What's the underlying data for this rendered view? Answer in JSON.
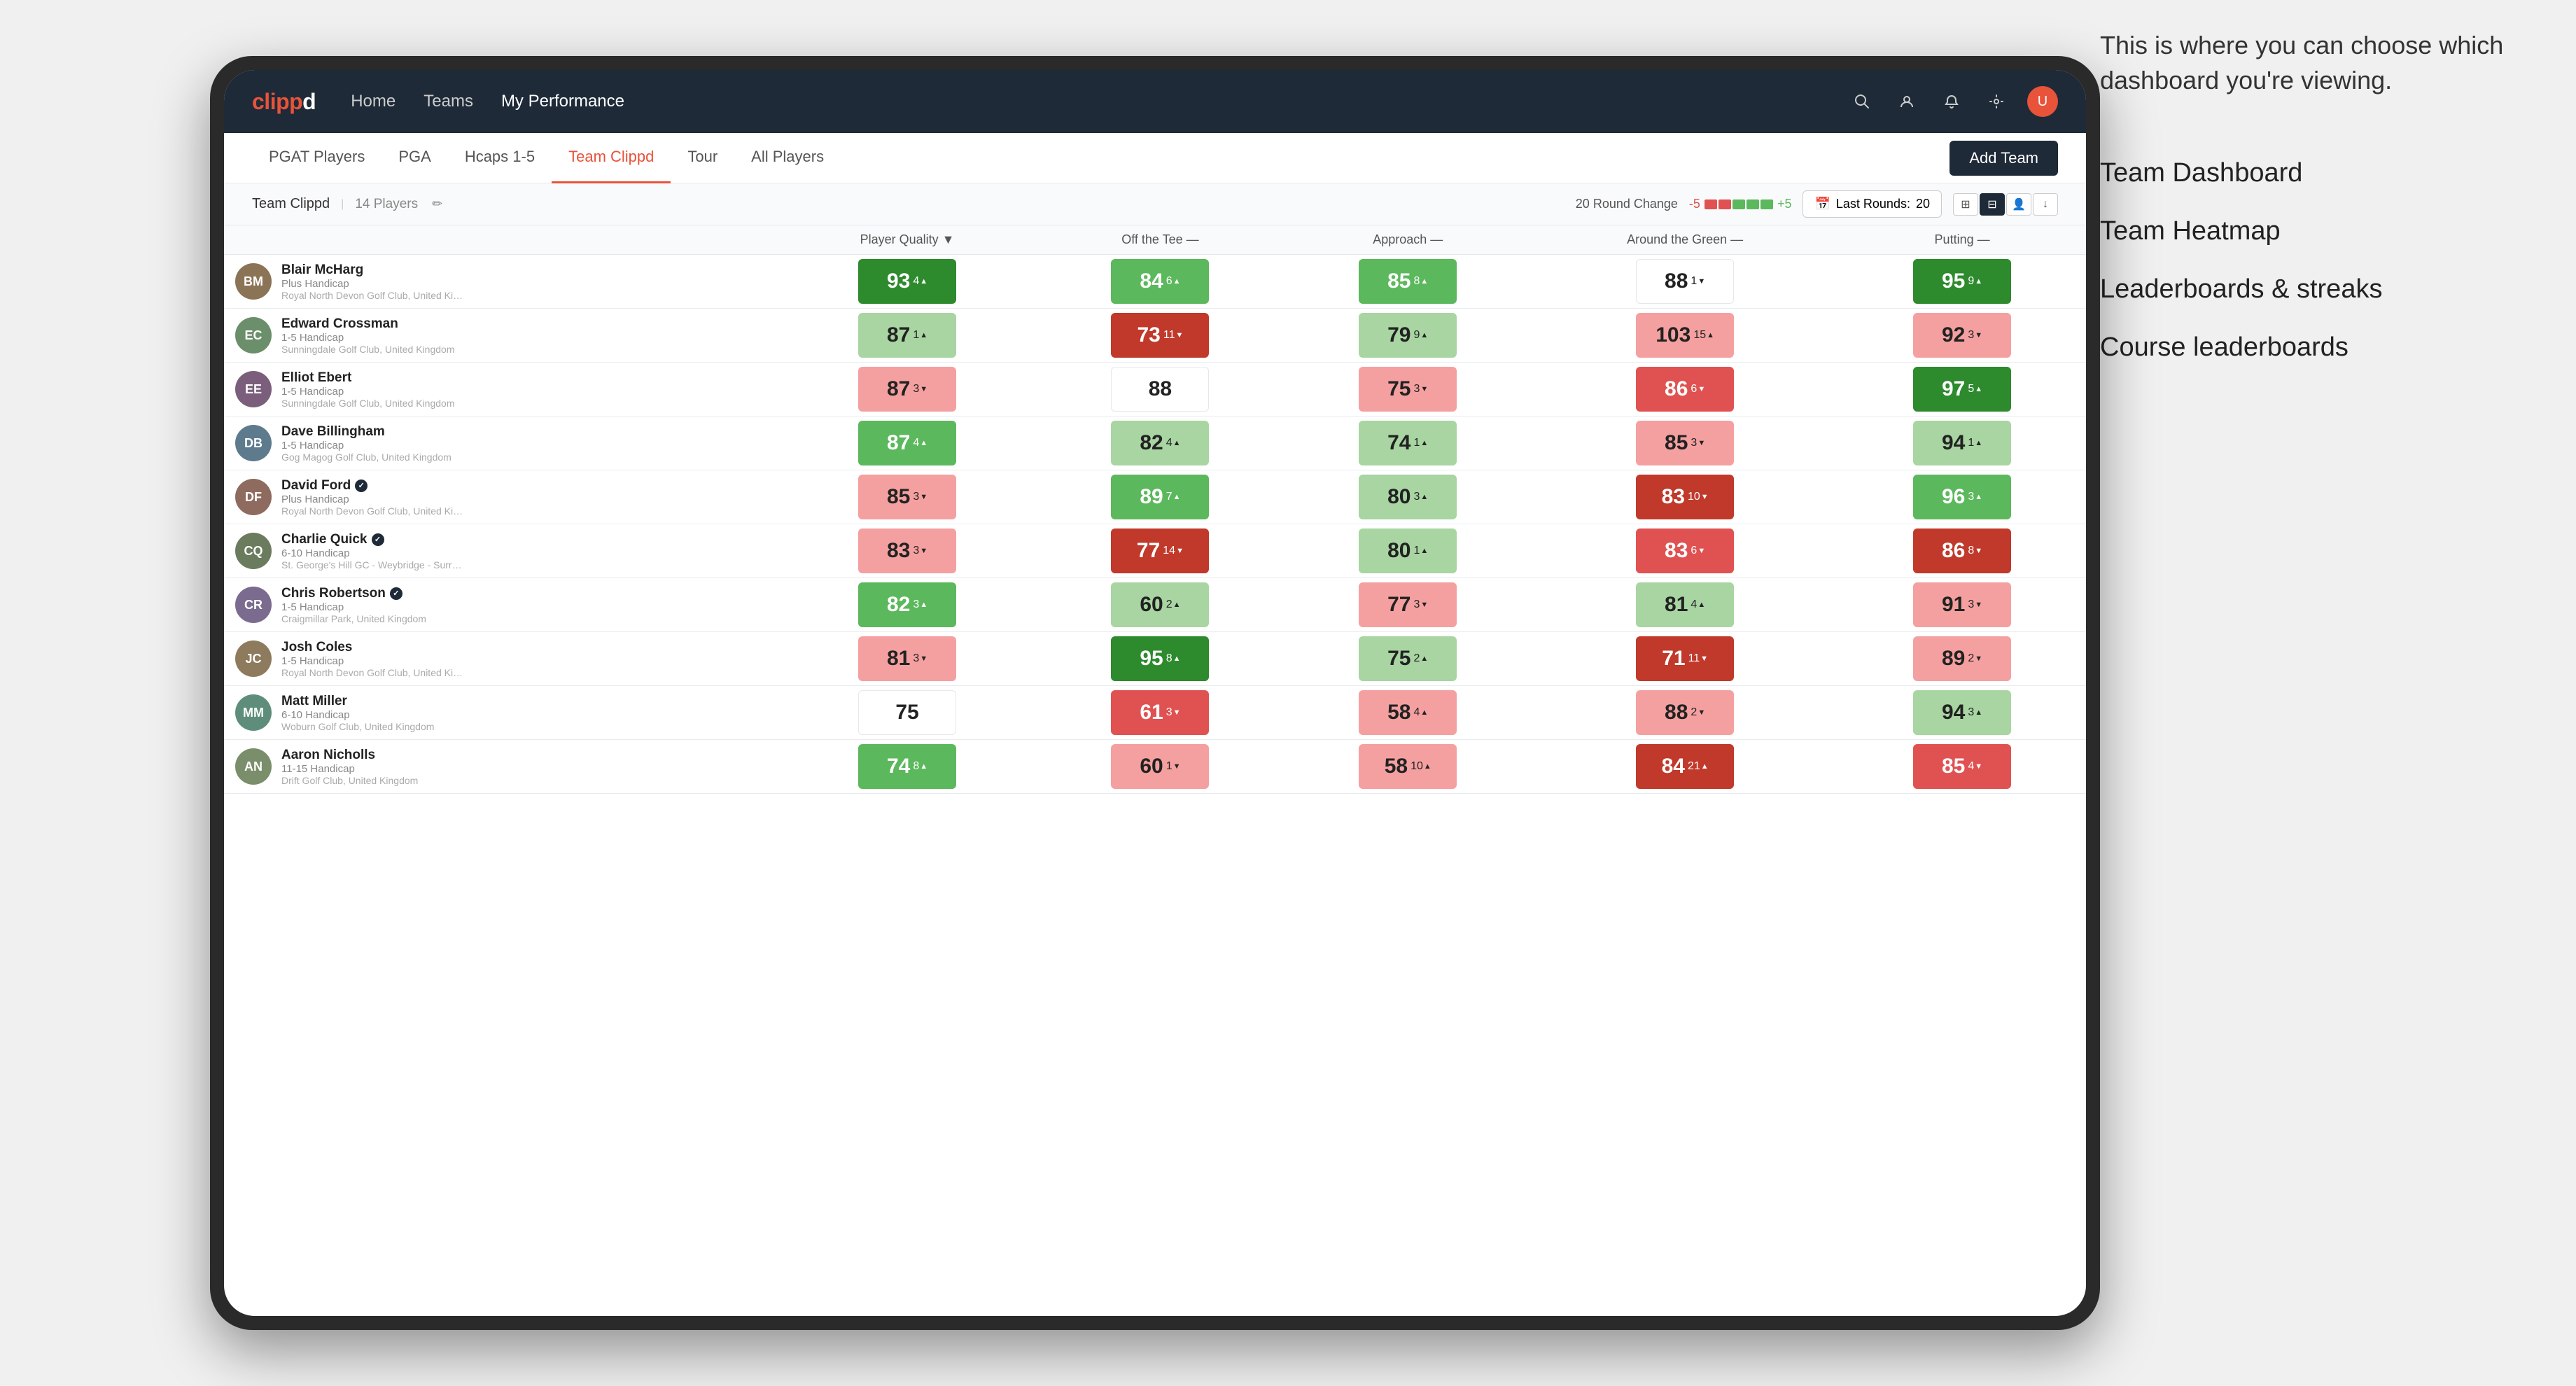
{
  "annotation": {
    "intro": "This is where you can choose which dashboard you're viewing.",
    "items": [
      "Team Dashboard",
      "Team Heatmap",
      "Leaderboards & streaks",
      "Course leaderboards"
    ]
  },
  "nav": {
    "logo": "clippd",
    "links": [
      "Home",
      "Teams",
      "My Performance"
    ],
    "active_link": "My Performance"
  },
  "sub_nav": {
    "links": [
      "PGAT Players",
      "PGA",
      "Hcaps 1-5",
      "Team Clippd",
      "Tour",
      "All Players"
    ],
    "active": "Team Clippd",
    "add_team_label": "Add Team"
  },
  "team_bar": {
    "team_name": "Team Clippd",
    "player_count": "14 Players",
    "round_change_label": "20 Round Change",
    "minus_num": "-5",
    "plus_num": "+5",
    "last_rounds_label": "Last Rounds:",
    "last_rounds_value": "20",
    "calendar_icon": "calendar"
  },
  "table": {
    "headers": {
      "player": "Player Quality ▼",
      "tee": "Off the Tee —",
      "approach": "Approach —",
      "around": "Around the Green —",
      "putting": "Putting —"
    },
    "rows": [
      {
        "name": "Blair McHarg",
        "handicap": "Plus Handicap",
        "club": "Royal North Devon Golf Club, United Kingdom",
        "badge": false,
        "quality": {
          "score": 93,
          "delta": "4",
          "dir": "up",
          "color": "green-dark"
        },
        "tee": {
          "score": 84,
          "delta": "6",
          "dir": "up",
          "color": "green-mid"
        },
        "approach": {
          "score": 85,
          "delta": "8",
          "dir": "up",
          "color": "green-mid"
        },
        "around": {
          "score": 88,
          "delta": "1",
          "dir": "down",
          "color": "white"
        },
        "putting": {
          "score": 95,
          "delta": "9",
          "dir": "up",
          "color": "green-dark"
        }
      },
      {
        "name": "Edward Crossman",
        "handicap": "1-5 Handicap",
        "club": "Sunningdale Golf Club, United Kingdom",
        "badge": false,
        "quality": {
          "score": 87,
          "delta": "1",
          "dir": "up",
          "color": "green-light"
        },
        "tee": {
          "score": 73,
          "delta": "11",
          "dir": "down",
          "color": "red-dark"
        },
        "approach": {
          "score": 79,
          "delta": "9",
          "dir": "up",
          "color": "green-light"
        },
        "around": {
          "score": 103,
          "delta": "15",
          "dir": "up",
          "color": "red-light"
        },
        "putting": {
          "score": 92,
          "delta": "3",
          "dir": "down",
          "color": "red-light"
        }
      },
      {
        "name": "Elliot Ebert",
        "handicap": "1-5 Handicap",
        "club": "Sunningdale Golf Club, United Kingdom",
        "badge": false,
        "quality": {
          "score": 87,
          "delta": "3",
          "dir": "down",
          "color": "red-light"
        },
        "tee": {
          "score": 88,
          "delta": "",
          "dir": "",
          "color": "white"
        },
        "approach": {
          "score": 75,
          "delta": "3",
          "dir": "down",
          "color": "red-light"
        },
        "around": {
          "score": 86,
          "delta": "6",
          "dir": "down",
          "color": "red-mid"
        },
        "putting": {
          "score": 97,
          "delta": "5",
          "dir": "up",
          "color": "green-dark"
        }
      },
      {
        "name": "Dave Billingham",
        "handicap": "1-5 Handicap",
        "club": "Gog Magog Golf Club, United Kingdom",
        "badge": false,
        "quality": {
          "score": 87,
          "delta": "4",
          "dir": "up",
          "color": "green-mid"
        },
        "tee": {
          "score": 82,
          "delta": "4",
          "dir": "up",
          "color": "green-light"
        },
        "approach": {
          "score": 74,
          "delta": "1",
          "dir": "up",
          "color": "green-light"
        },
        "around": {
          "score": 85,
          "delta": "3",
          "dir": "down",
          "color": "red-light"
        },
        "putting": {
          "score": 94,
          "delta": "1",
          "dir": "up",
          "color": "green-light"
        }
      },
      {
        "name": "David Ford",
        "handicap": "Plus Handicap",
        "club": "Royal North Devon Golf Club, United Kingdom",
        "badge": true,
        "quality": {
          "score": 85,
          "delta": "3",
          "dir": "down",
          "color": "red-light"
        },
        "tee": {
          "score": 89,
          "delta": "7",
          "dir": "up",
          "color": "green-mid"
        },
        "approach": {
          "score": 80,
          "delta": "3",
          "dir": "up",
          "color": "green-light"
        },
        "around": {
          "score": 83,
          "delta": "10",
          "dir": "down",
          "color": "red-dark"
        },
        "putting": {
          "score": 96,
          "delta": "3",
          "dir": "up",
          "color": "green-mid"
        }
      },
      {
        "name": "Charlie Quick",
        "handicap": "6-10 Handicap",
        "club": "St. George's Hill GC - Weybridge - Surrey, Uni...",
        "badge": true,
        "quality": {
          "score": 83,
          "delta": "3",
          "dir": "down",
          "color": "red-light"
        },
        "tee": {
          "score": 77,
          "delta": "14",
          "dir": "down",
          "color": "red-dark"
        },
        "approach": {
          "score": 80,
          "delta": "1",
          "dir": "up",
          "color": "green-light"
        },
        "around": {
          "score": 83,
          "delta": "6",
          "dir": "down",
          "color": "red-mid"
        },
        "putting": {
          "score": 86,
          "delta": "8",
          "dir": "down",
          "color": "red-dark"
        }
      },
      {
        "name": "Chris Robertson",
        "handicap": "1-5 Handicap",
        "club": "Craigmillar Park, United Kingdom",
        "badge": true,
        "quality": {
          "score": 82,
          "delta": "3",
          "dir": "up",
          "color": "green-mid"
        },
        "tee": {
          "score": 60,
          "delta": "2",
          "dir": "up",
          "color": "green-light"
        },
        "approach": {
          "score": 77,
          "delta": "3",
          "dir": "down",
          "color": "red-light"
        },
        "around": {
          "score": 81,
          "delta": "4",
          "dir": "up",
          "color": "green-light"
        },
        "putting": {
          "score": 91,
          "delta": "3",
          "dir": "down",
          "color": "red-light"
        }
      },
      {
        "name": "Josh Coles",
        "handicap": "1-5 Handicap",
        "club": "Royal North Devon Golf Club, United Kingdom",
        "badge": false,
        "quality": {
          "score": 81,
          "delta": "3",
          "dir": "down",
          "color": "red-light"
        },
        "tee": {
          "score": 95,
          "delta": "8",
          "dir": "up",
          "color": "green-dark"
        },
        "approach": {
          "score": 75,
          "delta": "2",
          "dir": "up",
          "color": "green-light"
        },
        "around": {
          "score": 71,
          "delta": "11",
          "dir": "down",
          "color": "red-dark"
        },
        "putting": {
          "score": 89,
          "delta": "2",
          "dir": "down",
          "color": "red-light"
        }
      },
      {
        "name": "Matt Miller",
        "handicap": "6-10 Handicap",
        "club": "Woburn Golf Club, United Kingdom",
        "badge": false,
        "quality": {
          "score": 75,
          "delta": "",
          "dir": "",
          "color": "white"
        },
        "tee": {
          "score": 61,
          "delta": "3",
          "dir": "down",
          "color": "red-mid"
        },
        "approach": {
          "score": 58,
          "delta": "4",
          "dir": "up",
          "color": "red-light"
        },
        "around": {
          "score": 88,
          "delta": "2",
          "dir": "down",
          "color": "red-light"
        },
        "putting": {
          "score": 94,
          "delta": "3",
          "dir": "up",
          "color": "green-light"
        }
      },
      {
        "name": "Aaron Nicholls",
        "handicap": "11-15 Handicap",
        "club": "Drift Golf Club, United Kingdom",
        "badge": false,
        "quality": {
          "score": 74,
          "delta": "8",
          "dir": "up",
          "color": "green-mid"
        },
        "tee": {
          "score": 60,
          "delta": "1",
          "dir": "down",
          "color": "red-light"
        },
        "approach": {
          "score": 58,
          "delta": "10",
          "dir": "up",
          "color": "red-light"
        },
        "around": {
          "score": 84,
          "delta": "21",
          "dir": "up",
          "color": "red-dark"
        },
        "putting": {
          "score": 85,
          "delta": "4",
          "dir": "down",
          "color": "red-mid"
        }
      }
    ]
  }
}
